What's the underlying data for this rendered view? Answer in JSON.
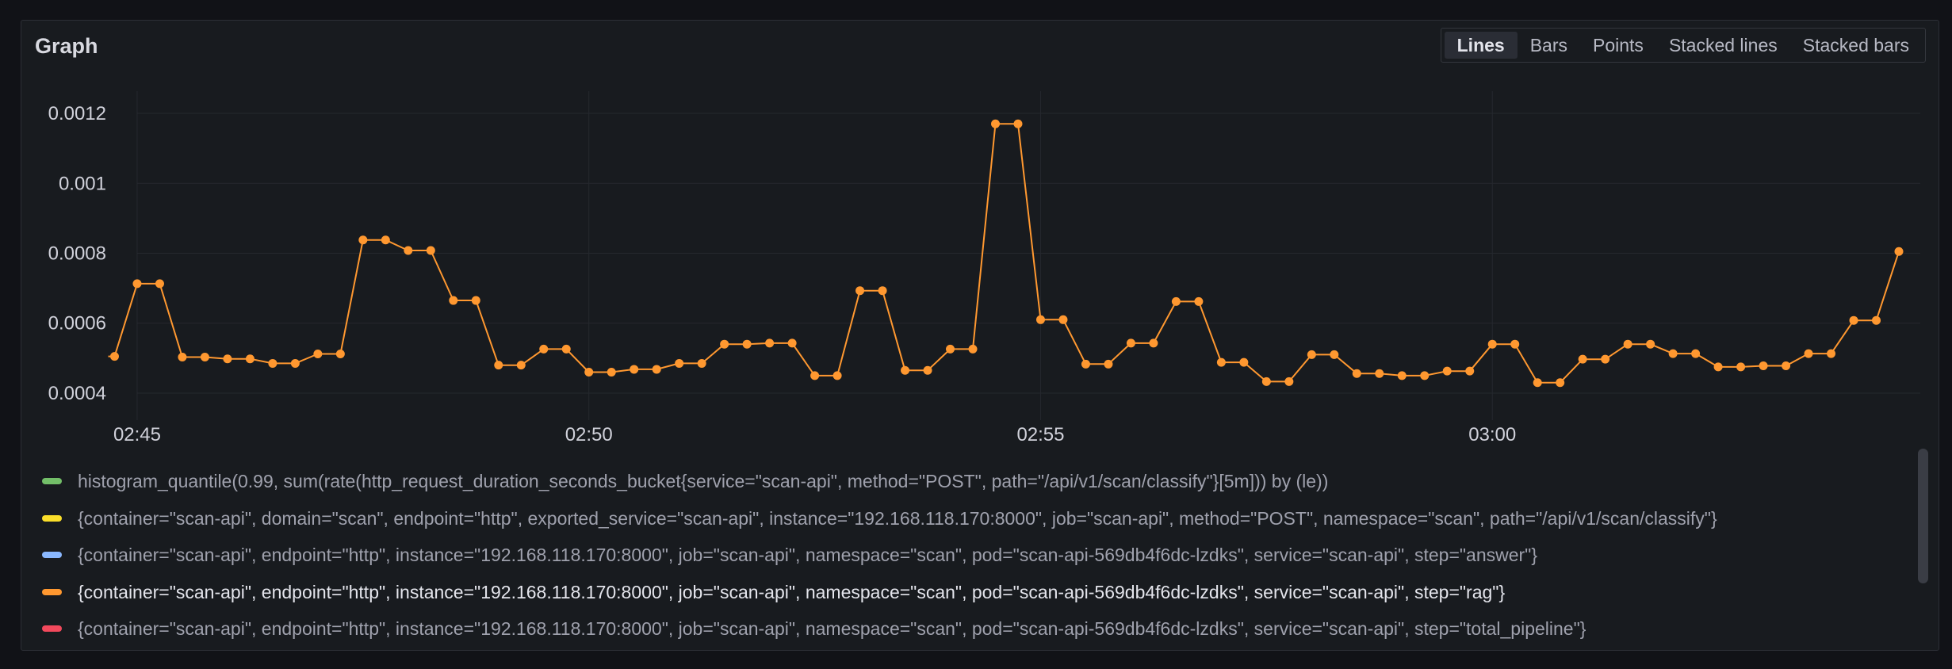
{
  "panel": {
    "title": "Graph"
  },
  "modes": [
    {
      "label": "Lines",
      "active": true
    },
    {
      "label": "Bars",
      "active": false
    },
    {
      "label": "Points",
      "active": false
    },
    {
      "label": "Stacked lines",
      "active": false
    },
    {
      "label": "Stacked bars",
      "active": false
    }
  ],
  "legend": [
    {
      "label": "histogram_quantile(0.99, sum(rate(http_request_duration_seconds_bucket{service=\"scan-api\", method=\"POST\", path=\"/api/v1/scan/classify\"}[5m])) by (le))",
      "color": "#73bf69"
    },
    {
      "label": "{container=\"scan-api\", domain=\"scan\", endpoint=\"http\", exported_service=\"scan-api\", instance=\"192.168.118.170:8000\", job=\"scan-api\", method=\"POST\", namespace=\"scan\", path=\"/api/v1/scan/classify\"}",
      "color": "#fade2a"
    },
    {
      "label": "{container=\"scan-api\", endpoint=\"http\", instance=\"192.168.118.170:8000\", job=\"scan-api\", namespace=\"scan\", pod=\"scan-api-569db4f6dc-lzdks\", service=\"scan-api\", step=\"answer\"}",
      "color": "#8ab8ff"
    },
    {
      "label": "{container=\"scan-api\", endpoint=\"http\", instance=\"192.168.118.170:8000\", job=\"scan-api\", namespace=\"scan\", pod=\"scan-api-569db4f6dc-lzdks\", service=\"scan-api\", step=\"rag\"}",
      "color": "#ff9830"
    },
    {
      "label": "{container=\"scan-api\", endpoint=\"http\", instance=\"192.168.118.170:8000\", job=\"scan-api\", namespace=\"scan\", pod=\"scan-api-569db4f6dc-lzdks\", service=\"scan-api\", step=\"total_pipeline\"}",
      "color": "#f2495c"
    }
  ],
  "chart_data": {
    "type": "line",
    "x_unit": "minutes",
    "xlim": [
      "02:44.5",
      "03:04.3"
    ],
    "ylim": [
      0.00035,
      0.00125
    ],
    "x_ticks": [
      {
        "label": "02:45",
        "value": 45
      },
      {
        "label": "02:50",
        "value": 50
      },
      {
        "label": "02:55",
        "value": 55
      },
      {
        "label": "03:00",
        "value": 60
      }
    ],
    "y_ticks": [
      {
        "label": "0.0004",
        "value": 0.0004
      },
      {
        "label": "0.0006",
        "value": 0.0006
      },
      {
        "label": "0.0008",
        "value": 0.0008
      },
      {
        "label": "0.001",
        "value": 0.001
      },
      {
        "label": "0.0012",
        "value": 0.0012
      }
    ],
    "grid": true,
    "series": [
      {
        "color": "#ff9830",
        "x": [
          44.75,
          45.0,
          45.25,
          45.5,
          45.75,
          46.0,
          46.25,
          46.5,
          46.75,
          47.0,
          47.25,
          47.5,
          47.75,
          48.0,
          48.25,
          48.5,
          48.75,
          49.0,
          49.25,
          49.5,
          49.75,
          50.0,
          50.25,
          50.5,
          50.75,
          51.0,
          51.25,
          51.5,
          51.75,
          52.0,
          52.25,
          52.5,
          52.75,
          53.0,
          53.25,
          53.5,
          53.75,
          54.0,
          54.25,
          54.5,
          54.75,
          55.0,
          55.25,
          55.5,
          55.75,
          56.0,
          56.25,
          56.5,
          56.75,
          57.0,
          57.25,
          57.5,
          57.75,
          58.0,
          58.25,
          58.5,
          58.75,
          59.0,
          59.25,
          59.5,
          59.75,
          60.0,
          60.25,
          60.5,
          60.75,
          61.0,
          61.25,
          61.5,
          61.75,
          62.0,
          62.25,
          62.5,
          62.75,
          63.0,
          63.25,
          63.5,
          63.75,
          64.0,
          64.25,
          64.5
        ],
        "values": [
          0.000505,
          0.000713,
          0.000713,
          0.000503,
          0.000503,
          0.000498,
          0.000498,
          0.000485,
          0.000485,
          0.000512,
          0.000512,
          0.000838,
          0.000838,
          0.000808,
          0.000808,
          0.000665,
          0.000665,
          0.00048,
          0.00048,
          0.000526,
          0.000526,
          0.00046,
          0.00046,
          0.000468,
          0.000468,
          0.000485,
          0.000485,
          0.00054,
          0.00054,
          0.000543,
          0.000543,
          0.00045,
          0.00045,
          0.000693,
          0.000693,
          0.000465,
          0.000465,
          0.000526,
          0.000526,
          0.00117,
          0.00117,
          0.00061,
          0.00061,
          0.000483,
          0.000483,
          0.000543,
          0.000543,
          0.000662,
          0.000662,
          0.000488,
          0.000488,
          0.000433,
          0.000433,
          0.00051,
          0.00051,
          0.000456,
          0.000456,
          0.00045,
          0.00045,
          0.000463,
          0.000463,
          0.00054,
          0.00054,
          0.00043,
          0.00043,
          0.000497,
          0.000497,
          0.00054,
          0.00054,
          0.000513,
          0.000513,
          0.000475,
          0.000475,
          0.000478,
          0.000478,
          0.000513,
          0.000513,
          0.000608,
          0.000608,
          0.000805
        ]
      }
    ]
  }
}
